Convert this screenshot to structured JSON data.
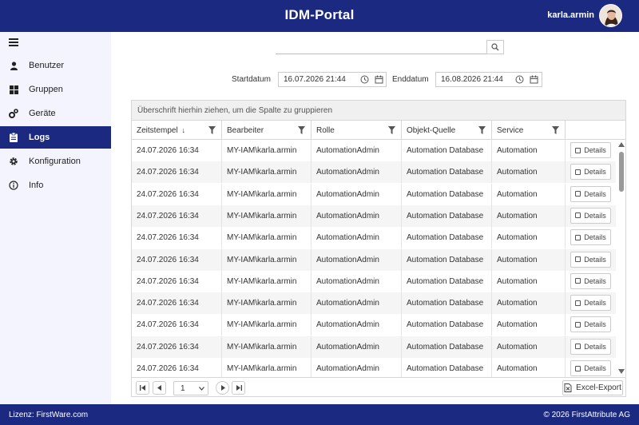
{
  "header": {
    "title": "IDM-Portal",
    "username": "karla.armin"
  },
  "sidebar": {
    "items": [
      {
        "label": "Benutzer",
        "icon": "user-icon"
      },
      {
        "label": "Gruppen",
        "icon": "grid-icon"
      },
      {
        "label": "Geräte",
        "icon": "gears-icon"
      },
      {
        "label": "Logs",
        "icon": "clipboard-icon",
        "active": true
      },
      {
        "label": "Konfiguration",
        "icon": "gear-icon"
      },
      {
        "label": "Info",
        "icon": "info-icon"
      }
    ]
  },
  "search": {
    "value": ""
  },
  "filters": {
    "start_label": "Startdatum",
    "start_value": "16.07.2026 21:44",
    "end_label": "Enddatum",
    "end_value": "16.08.2026 21:44"
  },
  "grid": {
    "group_hint": "Überschrift hierhin ziehen, um die Spalte zu gruppieren",
    "columns": [
      "Zeitstempel",
      "Bearbeiter",
      "Rolle",
      "Objekt-Quelle",
      "Service"
    ],
    "sort_indicator": "↓",
    "details_label": "Details",
    "rows": [
      [
        "24.07.2026 16:34",
        "MY-IAM\\karla.armin",
        "AutomationAdmin",
        "Automation Database",
        "Automation"
      ],
      [
        "24.07.2026 16:34",
        "MY-IAM\\karla.armin",
        "AutomationAdmin",
        "Automation Database",
        "Automation"
      ],
      [
        "24.07.2026 16:34",
        "MY-IAM\\karla.armin",
        "AutomationAdmin",
        "Automation Database",
        "Automation"
      ],
      [
        "24.07.2026 16:34",
        "MY-IAM\\karla.armin",
        "AutomationAdmin",
        "Automation Database",
        "Automation"
      ],
      [
        "24.07.2026 16:34",
        "MY-IAM\\karla.armin",
        "AutomationAdmin",
        "Automation Database",
        "Automation"
      ],
      [
        "24.07.2026 16:34",
        "MY-IAM\\karla.armin",
        "AutomationAdmin",
        "Automation Database",
        "Automation"
      ],
      [
        "24.07.2026 16:34",
        "MY-IAM\\karla.armin",
        "AutomationAdmin",
        "Automation Database",
        "Automation"
      ],
      [
        "24.07.2026 16:34",
        "MY-IAM\\karla.armin",
        "AutomationAdmin",
        "Automation Database",
        "Automation"
      ],
      [
        "24.07.2026 16:34",
        "MY-IAM\\karla.armin",
        "AutomationAdmin",
        "Automation Database",
        "Automation"
      ],
      [
        "24.07.2026 16:34",
        "MY-IAM\\karla.armin",
        "AutomationAdmin",
        "Automation Database",
        "Automation"
      ],
      [
        "24.07.2026 16:34",
        "MY-IAM\\karla.armin",
        "AutomationAdmin",
        "Automation Database",
        "Automation"
      ]
    ]
  },
  "pager": {
    "page": "1",
    "export_label": "Excel-Export"
  },
  "footer": {
    "license": "Lizenz: FirstWare.com",
    "copyright": "© 2026 FirstAttribute AG"
  },
  "colors": {
    "brand": "#1b2a80",
    "sidebar_bg": "#f3f4fd"
  }
}
